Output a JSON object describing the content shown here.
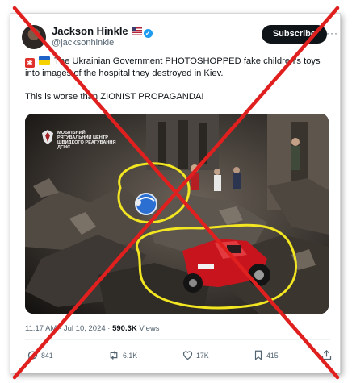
{
  "author": {
    "name": "Jackson Hinkle",
    "handle": "@jacksonhinkle",
    "flag_icon": "us-flag-icon",
    "badge_icon": "verified-badge-icon"
  },
  "header": {
    "subscribe_label": "Subscribe",
    "more_label": "···"
  },
  "tweet": {
    "text_line1": "The Ukrainian Government PHOTOSHOPPED fake children's toys into images of the hospital they destroyed in Kiev.",
    "text_line2": "This is worse than ZIONIST PROPAGANDA!",
    "lead_icons": [
      "red-cross-emoji-icon",
      "ukraine-flag-emoji-icon"
    ]
  },
  "media": {
    "logo_lines": [
      "МОБІЛЬНИЙ",
      "РЯТУВАЛЬНИЙ ЦЕНТР",
      "ШВИДКОГО РЕАГУВАННЯ",
      "ДСНС"
    ]
  },
  "meta": {
    "time": "11:17 AM",
    "date": "Jul 10, 2024",
    "views_count": "590.3K",
    "views_label": "Views",
    "separator": "·"
  },
  "actions": {
    "replies": "841",
    "reposts": "6.1K",
    "likes": "17K",
    "bookmarks": "415"
  },
  "overlay": {
    "mark": "red-x-icon",
    "color": "#e0201f"
  },
  "colors": {
    "accent": "#1d9bf0",
    "highlight": "#f2e522"
  }
}
